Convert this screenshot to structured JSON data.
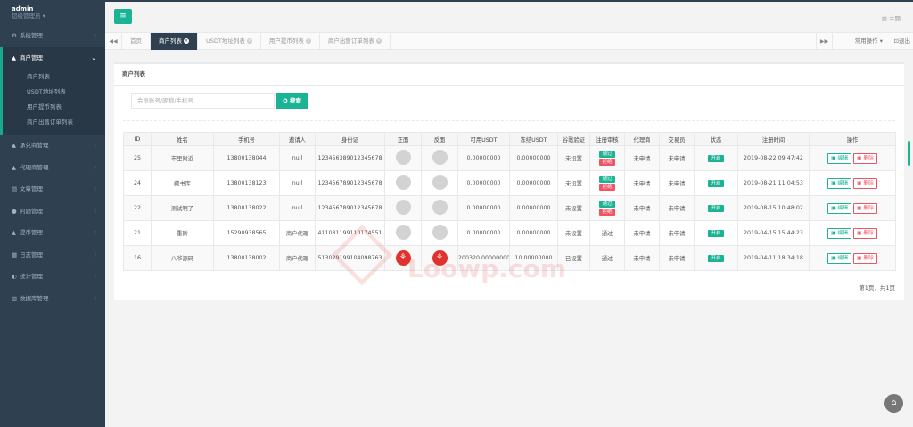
{
  "sidebar": {
    "user": "admin",
    "role": "超级管理员",
    "items": [
      {
        "icon": "gear-icon",
        "glyph": "⚙",
        "label": "系统管理"
      },
      {
        "icon": "user-icon",
        "glyph": "▲",
        "label": "商户管理",
        "active": true,
        "sub": [
          "商户列表",
          "USDT地址列表",
          "用户提币列表",
          "商户出售订单列表"
        ]
      },
      {
        "icon": "user-icon",
        "glyph": "▲",
        "label": "承兑商管理"
      },
      {
        "icon": "user-icon",
        "glyph": "▲",
        "label": "代理商管理"
      },
      {
        "icon": "book-icon",
        "glyph": "▤",
        "label": "文章管理"
      },
      {
        "icon": "chat-icon",
        "glyph": "●",
        "label": "问题管理"
      },
      {
        "icon": "user-icon",
        "glyph": "▲",
        "label": "提币管理"
      },
      {
        "icon": "log-icon",
        "glyph": "▦",
        "label": "日志管理"
      },
      {
        "icon": "stats-icon",
        "glyph": "◐",
        "label": "统计管理"
      },
      {
        "icon": "database-icon",
        "glyph": "▥",
        "label": "数据库管理"
      }
    ]
  },
  "topbar": {
    "menu_glyph": "≡",
    "theme": "▥ 主题"
  },
  "tabsbar": {
    "prev": "◀◀",
    "next": "▶▶",
    "tabs": [
      {
        "label": "首页",
        "closable": false
      },
      {
        "label": "商户列表",
        "closable": true,
        "active": true
      },
      {
        "label": "USDT地址列表",
        "closable": true
      },
      {
        "label": "用户提币列表",
        "closable": true
      },
      {
        "label": "商户出售订单列表",
        "closable": true
      }
    ],
    "close_glyph": "×",
    "common_ops": "常用操作 ▾",
    "logout": "⊡退出"
  },
  "panel": {
    "title": "商户列表",
    "search": {
      "placeholder": "会员账号/昵称/手机号",
      "button": "Q 搜索"
    },
    "columns": [
      "ID",
      "姓名",
      "手机号",
      "邀请人",
      "身份证",
      "正面",
      "反面",
      "可用USDT",
      "冻结USDT",
      "谷歌验证",
      "注册审核",
      "代理商",
      "交易员",
      "状态",
      "注册时间",
      "操作"
    ],
    "rows": [
      {
        "id": "25",
        "name": "市里附近",
        "phone": "13800138044",
        "inviter": "null",
        "idcard": "123456389012345678",
        "front": "gray",
        "back": "gray",
        "usdt": "0.00000000",
        "frozen": "0.00000000",
        "google": "未设置",
        "audit": "buttons",
        "agent": "未申请",
        "trader": "未申请",
        "status": "开启",
        "time": "2019-08-22 09:47:42"
      },
      {
        "id": "24",
        "name": "藏书库",
        "phone": "13800138123",
        "inviter": "null",
        "idcard": "123456789012345678",
        "front": "gray",
        "back": "gray",
        "usdt": "0.00000000",
        "frozen": "0.00000000",
        "google": "未设置",
        "audit": "buttons",
        "agent": "未申请",
        "trader": "未申请",
        "status": "开启",
        "time": "2019-08-21 11:04:53"
      },
      {
        "id": "22",
        "name": "测试啊了",
        "phone": "13800138022",
        "inviter": "null",
        "idcard": "123456789012345678",
        "front": "gray",
        "back": "gray",
        "usdt": "0.00000000",
        "frozen": "0.00000000",
        "google": "未设置",
        "audit": "buttons",
        "agent": "未申请",
        "trader": "未申请",
        "status": "开启",
        "time": "2019-08-15 10:48:02"
      },
      {
        "id": "21",
        "name": "重斯",
        "phone": "15290938565",
        "inviter": "商户代理",
        "idcard": "411081199110174551",
        "front": "gray",
        "back": "gray",
        "usdt": "0.00000000",
        "frozen": "0.00000000",
        "google": "未设置",
        "audit": "通过",
        "agent": "未申请",
        "trader": "未申请",
        "status": "开启",
        "time": "2019-04-15 15:44:23"
      },
      {
        "id": "16",
        "name": "八爷源码",
        "phone": "13800138002",
        "inviter": "商户代理",
        "idcard": "513029199104098763",
        "front": "red",
        "back": "red",
        "usdt": "200320.00000000",
        "frozen": "10.00000000",
        "google": "已设置",
        "audit": "通过",
        "agent": "未申请",
        "trader": "未申请",
        "status": "开启",
        "time": "2019-04-11 18:34:18"
      }
    ],
    "audit_pass": "通过",
    "audit_reject": "拒绝",
    "edit_label": "▣ 编辑",
    "delete_label": "▣ 删除",
    "page_info": "第1页，共1页"
  },
  "watermark": "Loowp.com",
  "fab_glyph": "⌂",
  "colors": {
    "sidebar": "#2f4050",
    "accent": "#1ab394",
    "danger": "#ed5565"
  }
}
